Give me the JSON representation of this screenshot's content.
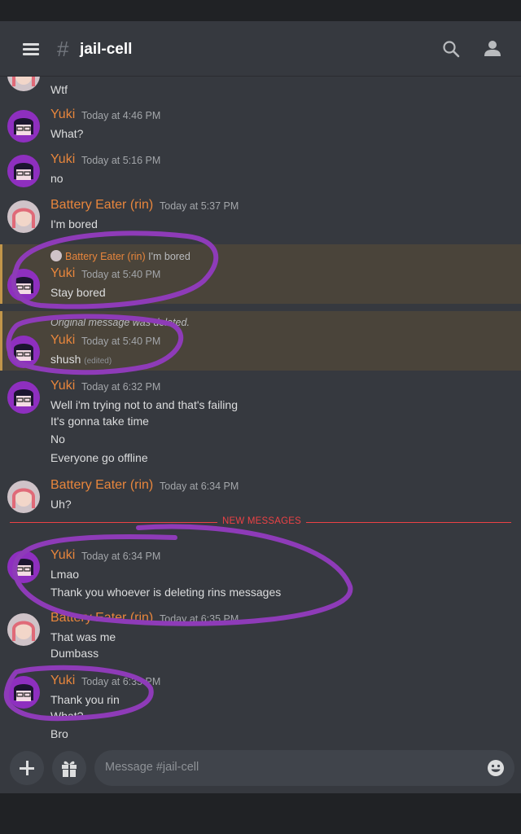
{
  "header": {
    "channel_hash": "#",
    "channel_name": "jail-cell",
    "menu_icon": "hamburger-menu-icon",
    "search_icon": "search-icon",
    "members_icon": "members-icon"
  },
  "colors": {
    "background": "#36393f",
    "username": "#e8863c",
    "new_messages": "#ed4245",
    "highlight": "#4a443a",
    "annotation_circle": "#8e3bb8"
  },
  "messages": [
    {
      "lines": [
        "Wtf"
      ]
    },
    {
      "author": "Yuki",
      "time": "Today at 4:46 PM",
      "lines": [
        "What?"
      ]
    },
    {
      "author": "Yuki",
      "time": "Today at 5:16 PM",
      "lines": [
        "no"
      ]
    },
    {
      "author": "Battery Eater (rin)",
      "time": "Today at 5:37 PM",
      "lines": [
        "I'm bored"
      ]
    },
    {
      "reply_author": "Battery Eater (rin)",
      "reply_text": "I'm bored",
      "author": "Yuki",
      "time": "Today at 5:40 PM",
      "lines": [
        "Stay bored"
      ]
    },
    {
      "deleted_note": "Original message was deleted.",
      "author": "Yuki",
      "time": "Today at 5:40 PM",
      "lines": [
        "shush"
      ],
      "edited": "(edited)"
    },
    {
      "author": "Yuki",
      "time": "Today at 6:32 PM",
      "lines": [
        "Well i'm trying not to and that's failing",
        "It's gonna take time",
        "No",
        "Everyone go offline"
      ]
    },
    {
      "author": "Battery Eater (rin)",
      "time": "Today at 6:34 PM",
      "lines": [
        "Uh?"
      ]
    },
    {
      "author": "Yuki",
      "time": "Today at 6:34 PM",
      "lines": [
        "Lmao",
        "Thank you whoever is deleting rins messages"
      ]
    },
    {
      "author": "Battery Eater (rin)",
      "time": "Today at 6:35 PM",
      "lines": [
        "That was me",
        "Dumbass"
      ]
    },
    {
      "author": "Yuki",
      "time": "Today at 6:35 PM",
      "lines": [
        "Thank you rin",
        "What?",
        "Bro"
      ]
    }
  ],
  "divider": {
    "label": "NEW MESSAGES"
  },
  "composer": {
    "placeholder": "Message #jail-cell",
    "add_icon": "plus-icon",
    "gift_icon": "gift-icon",
    "emoji_icon": "emoji-icon"
  }
}
